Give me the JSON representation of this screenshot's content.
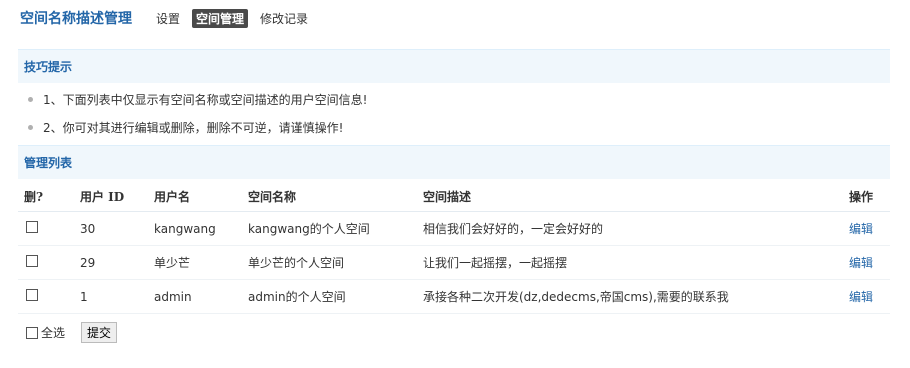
{
  "header": {
    "title": "空间名称描述管理",
    "tabs": [
      {
        "label": "设置",
        "active": false
      },
      {
        "label": "空间管理",
        "active": true
      },
      {
        "label": "修改记录",
        "active": false
      }
    ]
  },
  "tips": {
    "title": "技巧提示",
    "items": [
      "1、下面列表中仅显示有空间名称或空间描述的用户空间信息!",
      "2、你可对其进行编辑或删除，删除不可逆，请谨慎操作!"
    ]
  },
  "list": {
    "title": "管理列表",
    "columns": {
      "del": "删?",
      "uid": "用户 ID",
      "username": "用户名",
      "space_name": "空间名称",
      "space_desc": "空间描述",
      "op": "操作"
    },
    "rows": [
      {
        "uid": "30",
        "username": "kangwang",
        "space_name": "kangwang的个人空间",
        "space_desc": "相信我们会好好的，一定会好好的",
        "op": "编辑"
      },
      {
        "uid": "29",
        "username": "单少芒",
        "space_name": "单少芒的个人空间",
        "space_desc": "让我们一起摇摆，一起摇摆",
        "op": "编辑"
      },
      {
        "uid": "1",
        "username": "admin",
        "space_name": "admin的个人空间",
        "space_desc": "承接各种二次开发(dz,dedecms,帝国cms),需要的联系我",
        "op": "编辑"
      }
    ]
  },
  "footer": {
    "select_all_label": "全选",
    "submit_label": "提交"
  },
  "colors": {
    "accent": "#2366a8",
    "section_bg": "#f0f7fc",
    "active_tab_bg": "#4a4a4a"
  }
}
